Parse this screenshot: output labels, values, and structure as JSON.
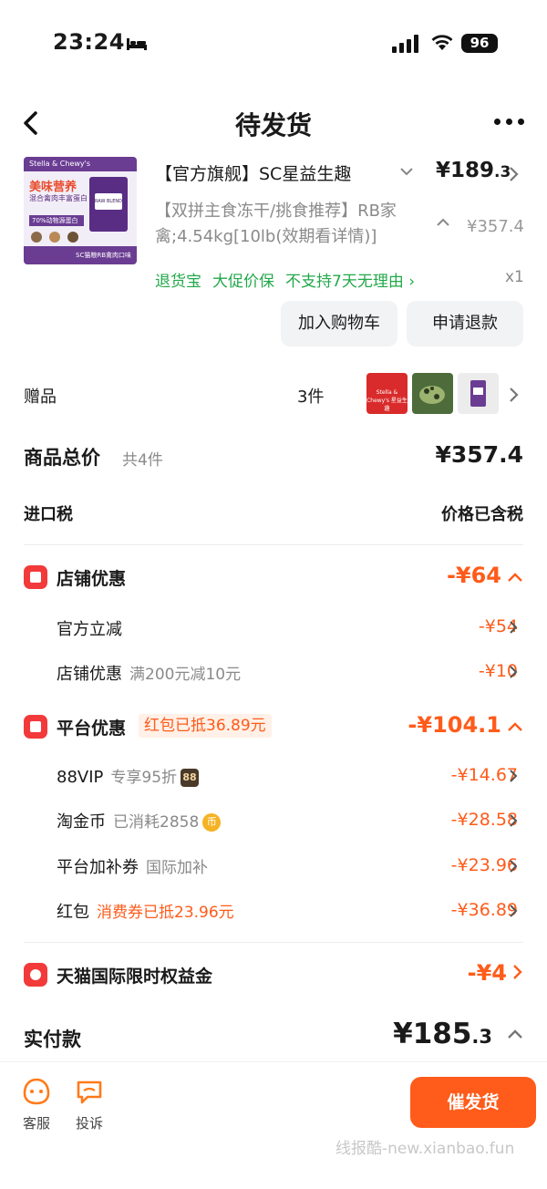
{
  "status_bar": {
    "time": "23:24",
    "battery": "96"
  },
  "nav": {
    "title": "待发货"
  },
  "product": {
    "image_texts": {
      "brand": "Stella & Chewy's",
      "title": "美味营养",
      "subtitle": "混合禽肉丰富蛋白",
      "tag": "70%动物源蛋白",
      "bag_label": "RAW BLEND",
      "caption": "SC猫粮RB禽肉口味"
    },
    "name": "【官方旗舰】SC星益生趣",
    "price_main": "¥189",
    "price_decimal": ".3",
    "sku": "【双拼主食冻干/挑食推荐】RB家禽;4.54kg[10lb(效期看详情)]",
    "original_price": "¥357.4",
    "tags": [
      "退货宝",
      "大促价保",
      "不支持7天无理由 ›"
    ],
    "quantity": "x1",
    "btn_cart": "加入购物车",
    "btn_refund": "申请退款"
  },
  "gifts": {
    "label": "赠品",
    "count": "3件",
    "thumb1_text": "Stella & Chewy's 星益生趣"
  },
  "totals": {
    "label": "商品总价",
    "count_note": "共4件",
    "price": "¥357.4",
    "tax_label": "进口税",
    "tax_value": "价格已含税"
  },
  "store_discount": {
    "title": "店铺优惠",
    "amount": "-¥64",
    "items": [
      {
        "label": "官方立减",
        "note": "",
        "amount": "-¥54"
      },
      {
        "label": "店铺优惠",
        "note": "满200元减10元",
        "amount": "-¥10"
      }
    ]
  },
  "platform_discount": {
    "title": "平台优惠",
    "tag": "红包已抵36.89元",
    "amount": "-¥104.1",
    "items": [
      {
        "label": "88VIP",
        "note": "专享95折",
        "badge": "88",
        "amount": "-¥14.67"
      },
      {
        "label": "淘金币",
        "note": "已消耗2858",
        "badge": "币",
        "amount": "-¥28.58"
      },
      {
        "label": "平台加补券",
        "note": "国际加补",
        "amount": "-¥23.96"
      },
      {
        "label": "红包",
        "note": "消费券已抵23.96元",
        "amount": "-¥36.89"
      }
    ]
  },
  "tmall_benefit": {
    "title": "天猫国际限时权益金",
    "amount": "-¥4"
  },
  "paid": {
    "label": "实付款",
    "main": "¥185",
    "decimal": ".3"
  },
  "bottom": {
    "service": "客服",
    "complain": "投诉",
    "urge": "催发货",
    "watermark": "线报酷-new.xianbao.fun"
  },
  "colors": {
    "accent": "#ff5b1a",
    "green": "#22a84a",
    "red_icon": "#f23a3a"
  }
}
